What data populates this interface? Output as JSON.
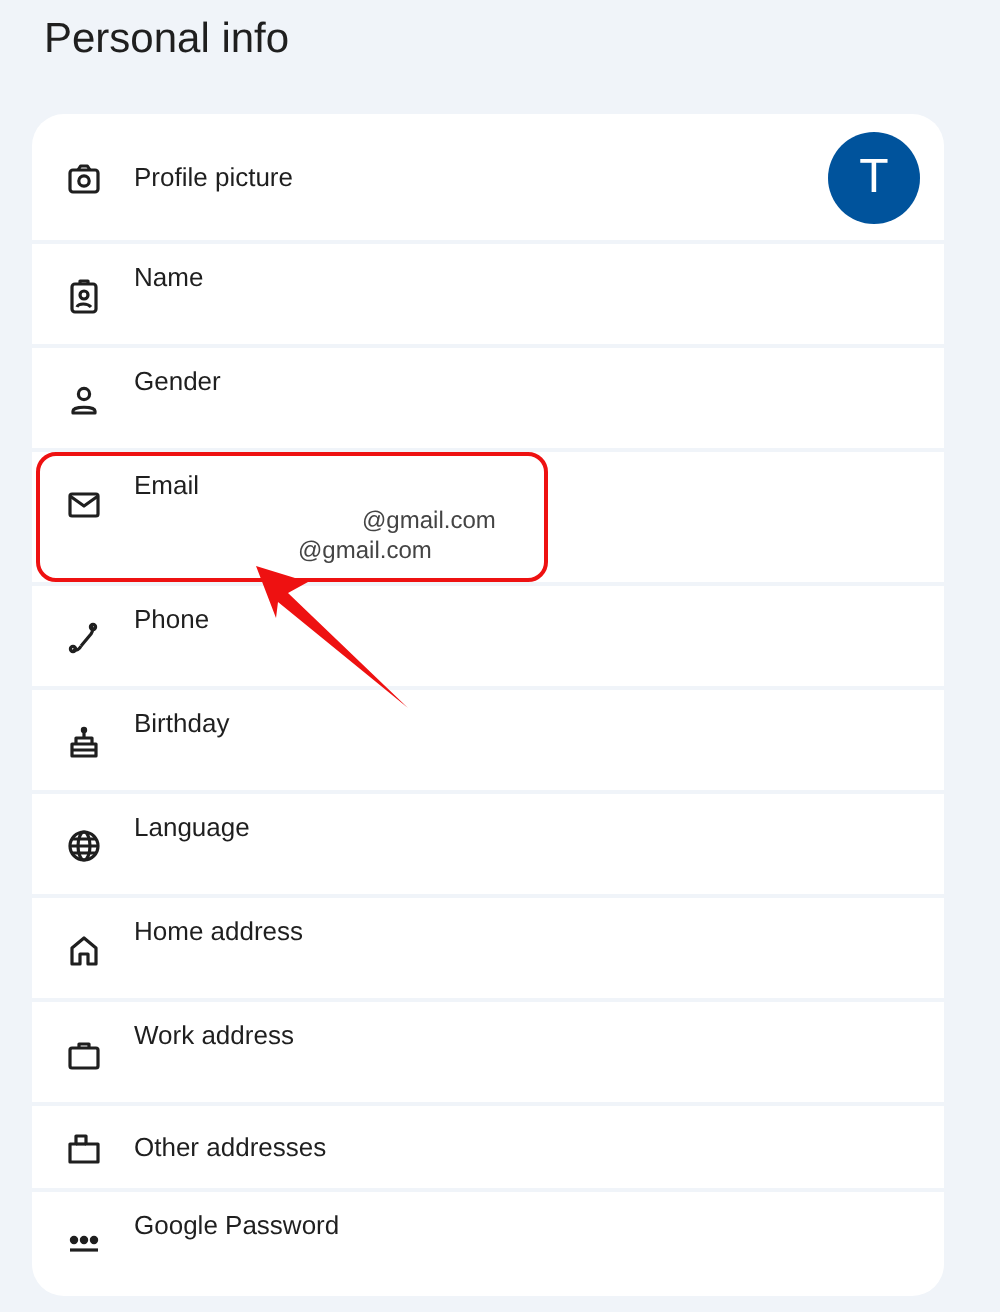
{
  "title": "Personal info",
  "rows": [
    {
      "kind": "avatar",
      "label": "Profile picture",
      "avatar": "T",
      "highlighted": false
    },
    {
      "kind": "field",
      "label": "Name",
      "highlighted": false
    },
    {
      "kind": "field",
      "label": "Gender",
      "highlighted": false
    },
    {
      "kind": "field",
      "label": "Email",
      "values": [
        "@gmail.com",
        "@gmail.com"
      ],
      "highlighted": true
    },
    {
      "kind": "field",
      "label": "Phone",
      "highlighted": false
    },
    {
      "kind": "field",
      "label": "Birthday",
      "highlighted": false
    },
    {
      "kind": "field",
      "label": "Language",
      "highlighted": false
    },
    {
      "kind": "field",
      "label": "Home address",
      "highlighted": false
    },
    {
      "kind": "field",
      "label": "Work address",
      "highlighted": false
    },
    {
      "kind": "plain",
      "label": "Other addresses",
      "highlighted": false
    },
    {
      "kind": "field",
      "label": "Google Password",
      "highlighted": false
    }
  ]
}
